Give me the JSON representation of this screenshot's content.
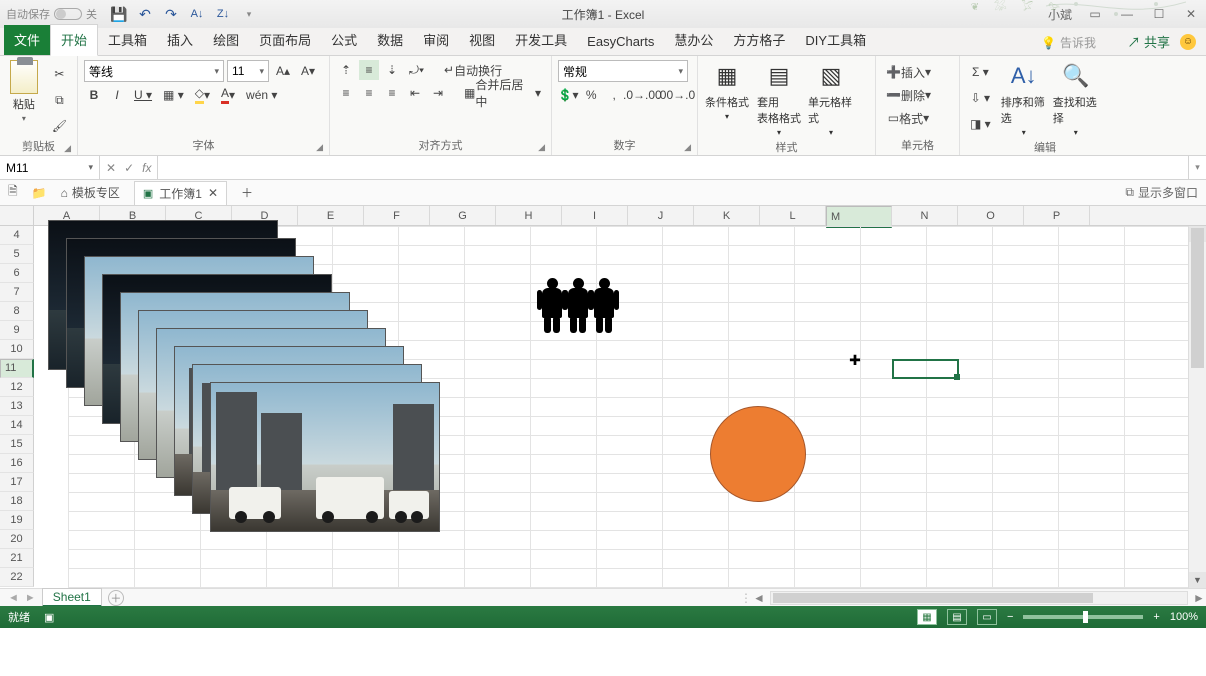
{
  "titlebar": {
    "autosave": "自动保存",
    "autosave_state": "关",
    "title": "工作簿1 - Excel",
    "user": "小斌"
  },
  "tabs": {
    "file": "文件",
    "items": [
      "开始",
      "工具箱",
      "插入",
      "绘图",
      "页面布局",
      "公式",
      "数据",
      "审阅",
      "视图",
      "开发工具",
      "EasyCharts",
      "慧办公",
      "方方格子",
      "DIY工具箱"
    ],
    "tell_me": "告诉我",
    "share": "共享"
  },
  "ribbon": {
    "clipboard": {
      "paste": "粘贴",
      "label": "剪贴板"
    },
    "font": {
      "name": "等线",
      "size": "11",
      "label": "字体"
    },
    "align": {
      "wrap": "自动换行",
      "merge": "合并后居中",
      "label": "对齐方式"
    },
    "number": {
      "format": "常规",
      "label": "数字"
    },
    "styles": {
      "cond": "条件格式",
      "table": "套用\n表格格式",
      "cell": "单元格样式",
      "label": "样式"
    },
    "cells": {
      "insert": "插入",
      "delete": "删除",
      "format": "格式",
      "label": "单元格"
    },
    "editing": {
      "sort": "排序和筛选",
      "find": "查找和选择",
      "label": "编辑"
    }
  },
  "fx": {
    "name": "M11",
    "value": ""
  },
  "wb": {
    "templates": "模板专区",
    "book": "工作簿1",
    "multi": "显示多窗口"
  },
  "grid": {
    "cols": [
      "A",
      "B",
      "C",
      "D",
      "E",
      "F",
      "G",
      "H",
      "I",
      "J",
      "K",
      "L",
      "M",
      "N",
      "O",
      "P"
    ],
    "first_row": 4,
    "selected_col": "M",
    "selected_row": 11
  },
  "sheets": {
    "active": "Sheet1"
  },
  "status": {
    "ready": "就绪",
    "zoom": "100%"
  }
}
